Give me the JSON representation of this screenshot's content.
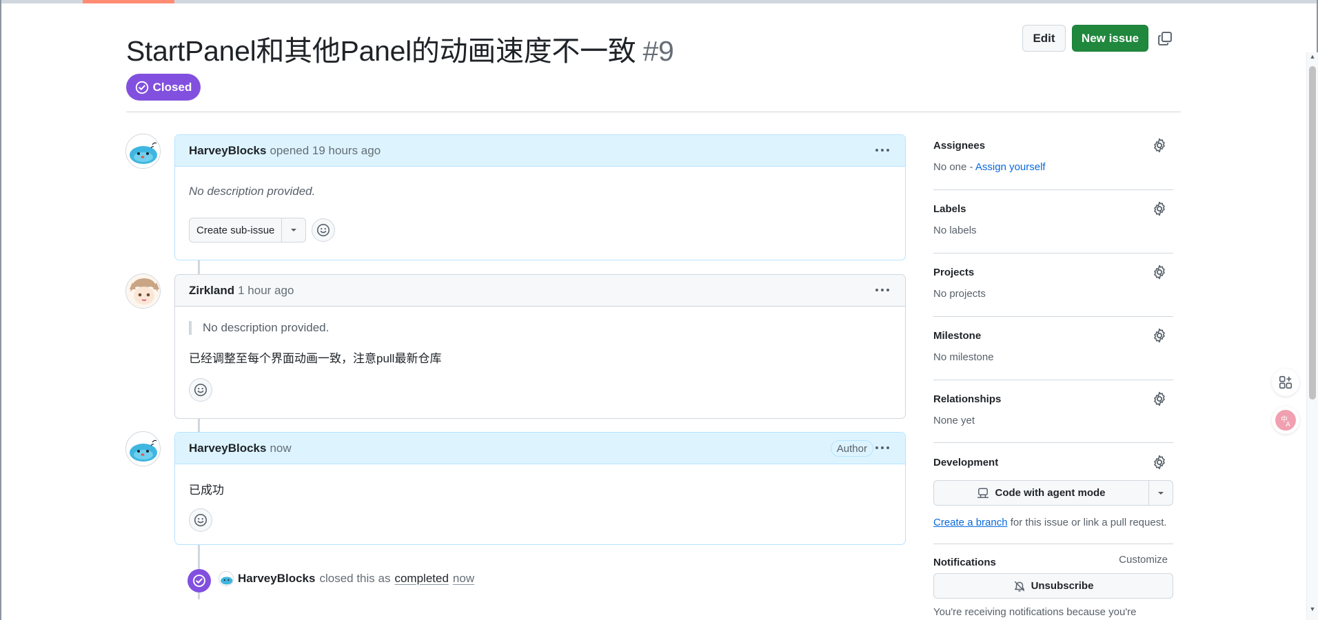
{
  "issue": {
    "title": "StartPanel和其他Panel的动画速度不一致",
    "number": "#9",
    "state": "Closed",
    "edit_label": "Edit",
    "new_issue_label": "New issue"
  },
  "comments": [
    {
      "author": "HarveyBlocks",
      "meta": "opened 19 hours ago",
      "body": "No description provided.",
      "create_sub_issue_label": "Create sub-issue"
    },
    {
      "author": "Zirkland",
      "meta": "1 hour ago",
      "quote": "No description provided.",
      "body": "已经调整至每个界面动画一致，注意pull最新仓库"
    },
    {
      "author": "HarveyBlocks",
      "meta": "now",
      "badge": "Author",
      "body": "已成功"
    }
  ],
  "event": {
    "author": "HarveyBlocks",
    "action": "closed this as",
    "state_link": "completed",
    "time_link": "now"
  },
  "sidebar": {
    "assignees": {
      "title": "Assignees",
      "value": "No one -",
      "link": "Assign yourself"
    },
    "labels": {
      "title": "Labels",
      "value": "No labels"
    },
    "projects": {
      "title": "Projects",
      "value": "No projects"
    },
    "milestone": {
      "title": "Milestone",
      "value": "No milestone"
    },
    "relationships": {
      "title": "Relationships",
      "value": "None yet"
    },
    "development": {
      "title": "Development",
      "agent_button": "Code with agent mode",
      "branch_link": "Create a branch",
      "branch_text": "for this issue or link a pull request."
    },
    "notifications": {
      "title": "Notifications",
      "customize": "Customize",
      "unsubscribe": "Unsubscribe",
      "reason": "You're receiving notifications because you're"
    }
  },
  "colors": {
    "closed_purple": "#8250df",
    "primary_green": "#1f883d",
    "link_blue": "#0969da",
    "author_header_bg": "#ddf4ff"
  }
}
